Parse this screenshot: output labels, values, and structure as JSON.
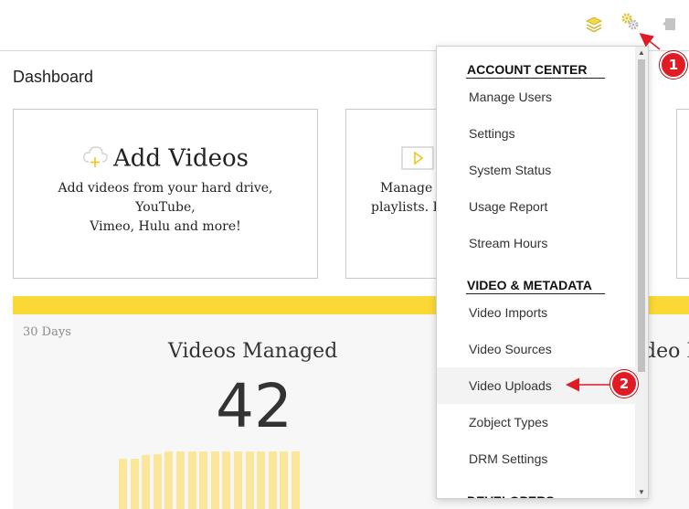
{
  "page": {
    "title": "Dashboard"
  },
  "topbar": {
    "icons": [
      "layers-icon",
      "gear-icon",
      "exit-icon"
    ]
  },
  "cards": {
    "add_videos": {
      "title": "Add Videos",
      "desc_line1": "Add videos from your hard drive, YouTube,",
      "desc_line2": "Vimeo, Hulu and more!"
    },
    "manage": {
      "desc_line1": "Manage y",
      "desc_line2": "playlists. E"
    }
  },
  "stats": {
    "range": "30 Days",
    "title": "Videos Managed",
    "value": "42",
    "right_title": "deo I",
    "bar_levels": [
      0.55,
      0.55,
      0.59,
      0.6,
      0.63,
      0.63,
      0.63,
      0.63,
      0.63,
      0.63,
      0.63,
      0.63,
      0.63,
      0.63,
      0.63,
      0.63
    ]
  },
  "menu": {
    "sections": [
      {
        "heading": "ACCOUNT CENTER",
        "items": [
          "Manage Users",
          "Settings",
          "System Status",
          "Usage Report",
          "Stream Hours"
        ]
      },
      {
        "heading": "VIDEO & METADATA",
        "items": [
          "Video Imports",
          "Video Sources",
          "Video Uploads",
          "Zobject Types",
          "DRM Settings"
        ]
      },
      {
        "heading": "DEVELOPERS"
      }
    ],
    "highlighted": "Video Uploads"
  },
  "annotations": {
    "step1": "1",
    "step2": "2"
  },
  "colors": {
    "accent_yellow": "#fad937",
    "badge_red": "#e01b24"
  }
}
